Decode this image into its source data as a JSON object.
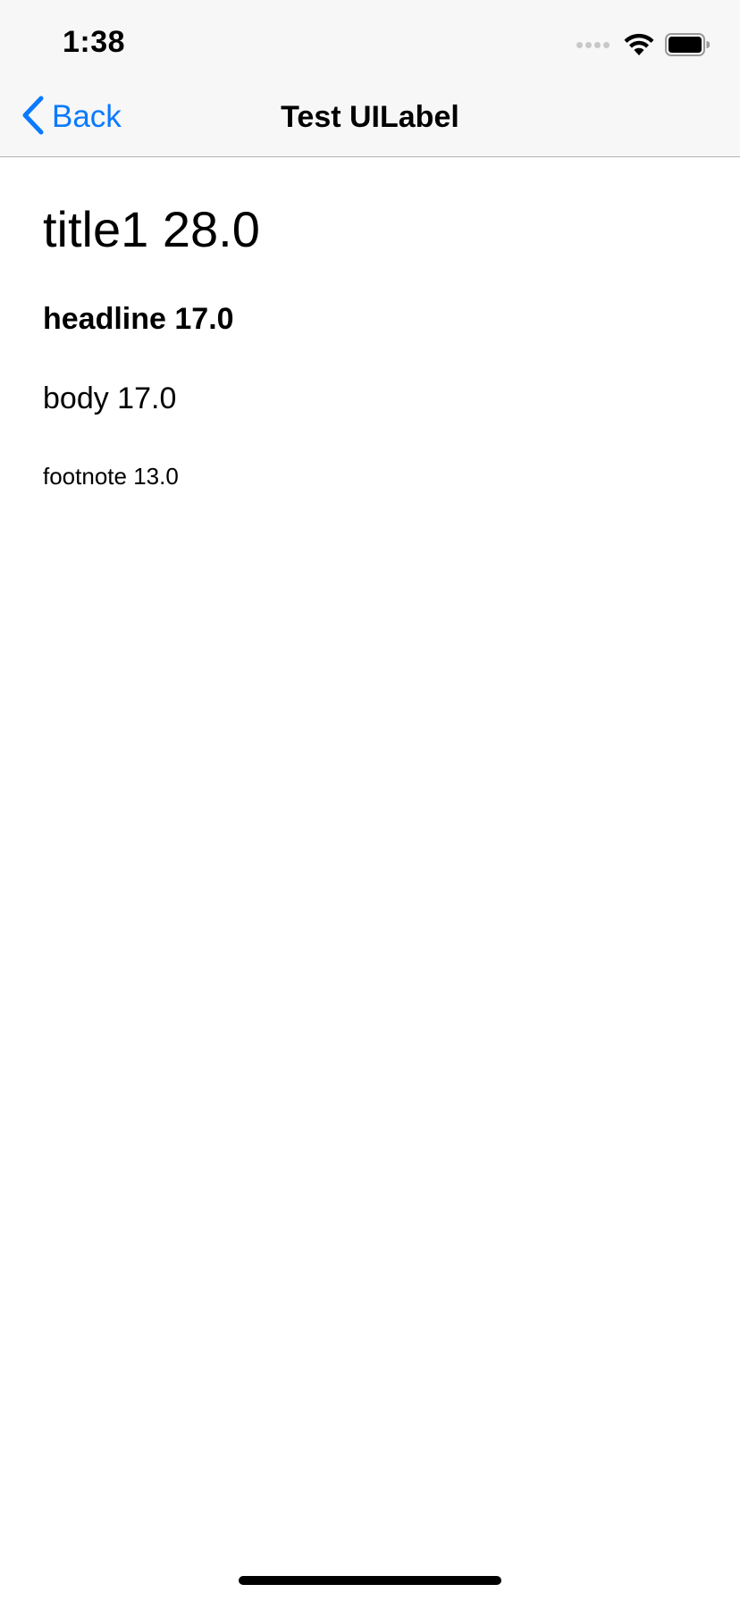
{
  "status_bar": {
    "time": "1:38"
  },
  "nav_bar": {
    "back_label": "Back",
    "title": "Test UILabel"
  },
  "labels": {
    "title1": "title1 28.0",
    "headline": "headline 17.0",
    "body": "body 17.0",
    "footnote": "footnote 13.0"
  },
  "icons": {
    "back": "chevron-left-icon",
    "wifi": "wifi-icon",
    "battery": "battery-icon",
    "signal": "cellular-signal-icon"
  },
  "colors": {
    "accent": "#0a7aff",
    "nav_background": "#f7f7f7",
    "separator": "#b2b2b2"
  }
}
